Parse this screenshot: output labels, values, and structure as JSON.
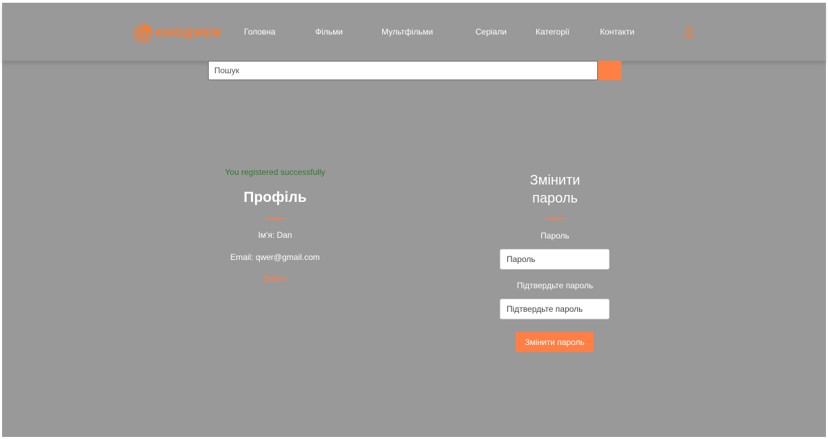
{
  "header": {
    "logo_text": "КІНОДЖЕМ",
    "nav": [
      {
        "label": "Головна"
      },
      {
        "label": "Фільми"
      },
      {
        "label": "Мультфільми"
      },
      {
        "label": "Серіали"
      },
      {
        "label": "Категорії"
      },
      {
        "label": "Контакти"
      }
    ],
    "user_icon": "user-icon"
  },
  "search": {
    "placeholder": "Пошук",
    "value": "",
    "button_icon": "search-icon"
  },
  "profile": {
    "success_message": "You registered successfully",
    "title": "Профіль",
    "name_line": "Ім'я: Dan",
    "email_line": "Email: qwer@gmail.com",
    "logout_label": "Вийти"
  },
  "change_password": {
    "title_line1": "Змінити",
    "title_line2": "пароль",
    "password_label": "Пароль",
    "password_placeholder": "Пароль",
    "confirm_label": "Підтвердьте пароль",
    "confirm_placeholder": "Підтвердьте пароль",
    "submit_label": "Змінити пароль"
  },
  "colors": {
    "accent": "#ff7f45",
    "background": "#999999",
    "success": "#2a7d2a",
    "text": "#ffffff"
  }
}
